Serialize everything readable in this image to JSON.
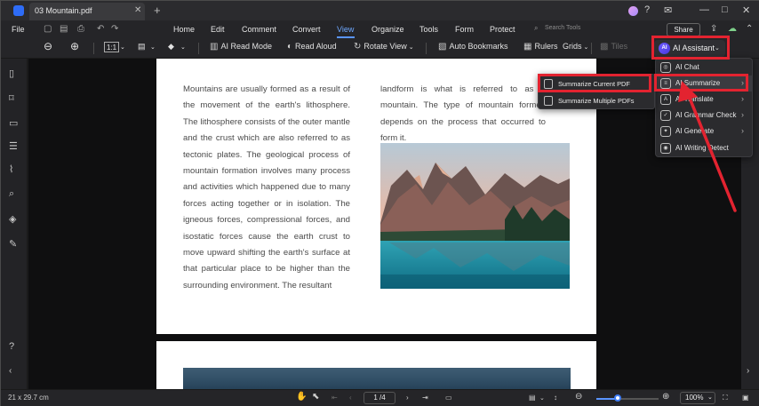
{
  "titlebar": {
    "tab_title": "03 Mountain.pdf",
    "tab_close": "✕",
    "new_tab": "+",
    "window_buttons": [
      "?",
      "✉",
      "—",
      "□",
      "✕"
    ]
  },
  "menubar": {
    "file": "File",
    "items": [
      "Home",
      "Edit",
      "Comment",
      "Convert",
      "View",
      "Organize",
      "Tools",
      "Form",
      "Protect"
    ],
    "active": "View",
    "search_placeholder": "Search Tools",
    "share": "Share"
  },
  "toolbar": {
    "fit_label": "1:1",
    "ai_read_mode": "AI Read Mode",
    "read_aloud": "Read Aloud",
    "rotate_view": "Rotate View",
    "auto_bookmarks": "Auto Bookmarks",
    "rulers": "Rulers",
    "grids": "Grids",
    "tiles": "Tiles",
    "ai_assistant": "AI Assistant",
    "ai_logo": "AI"
  },
  "document": {
    "left_column": "Mountains are usually formed as a result of the movement of the earth's lithosphere. The lithosphere consists of the outer mantle and the crust which are also referred to as tectonic plates. The geological process of mountain formation involves many process and activities which happened due to many forces acting together or in isolation. The igneous forces, compressional forces, and isostatic forces cause the earth crust to move upward shifting the earth's surface at that particular place to be higher than the surrounding environment. The resultant",
    "right_column": "landform is what is referred to as a mountain. The type of mountain formed depends on the process that occurred to form it."
  },
  "ai_menu": {
    "items": [
      {
        "label": "AI Chat",
        "icon": "chat-icon",
        "glyph": "◎",
        "submenu": false
      },
      {
        "label": "AI Summarize",
        "icon": "summarize-icon",
        "glyph": "≡",
        "submenu": true
      },
      {
        "label": "AI Translate",
        "icon": "translate-icon",
        "glyph": "A",
        "submenu": true
      },
      {
        "label": "AI Grammar Check",
        "icon": "grammar-icon",
        "glyph": "✓",
        "submenu": true
      },
      {
        "label": "AI Generate",
        "icon": "generate-icon",
        "glyph": "✦",
        "submenu": true
      },
      {
        "label": "AI Writing Detect",
        "icon": "detect-icon",
        "glyph": "◉",
        "submenu": false
      }
    ],
    "arrow": "›"
  },
  "summarize_submenu": {
    "items": [
      "Summarize Current PDF",
      "Summarize Multiple PDFs"
    ]
  },
  "statusbar": {
    "page_size": "21 x 29.7 cm",
    "page_indicator": "1 /4",
    "zoom": "100%",
    "zoom_level": 0.34
  },
  "colors": {
    "accent": "#5a95ff",
    "highlight_red": "#e32330"
  }
}
